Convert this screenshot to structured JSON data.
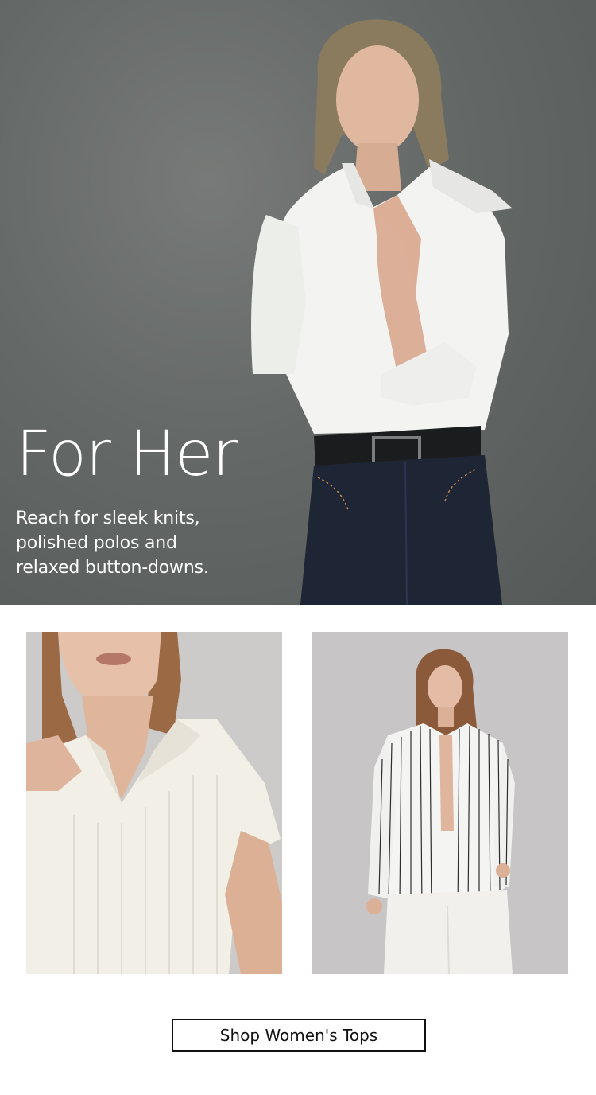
{
  "hero": {
    "title": "For Her",
    "subtitle": "Reach for sleek knits, polished polos and relaxed button-downs."
  },
  "tiles": [
    {
      "label": "ribbed-polo-top-photo"
    },
    {
      "label": "striped-button-down-photo"
    }
  ],
  "cta": {
    "label": "Shop Women's Tops"
  },
  "colors": {
    "hero_background": "#646866",
    "text_on_hero": "#ffffff",
    "cta_border": "#111111"
  }
}
